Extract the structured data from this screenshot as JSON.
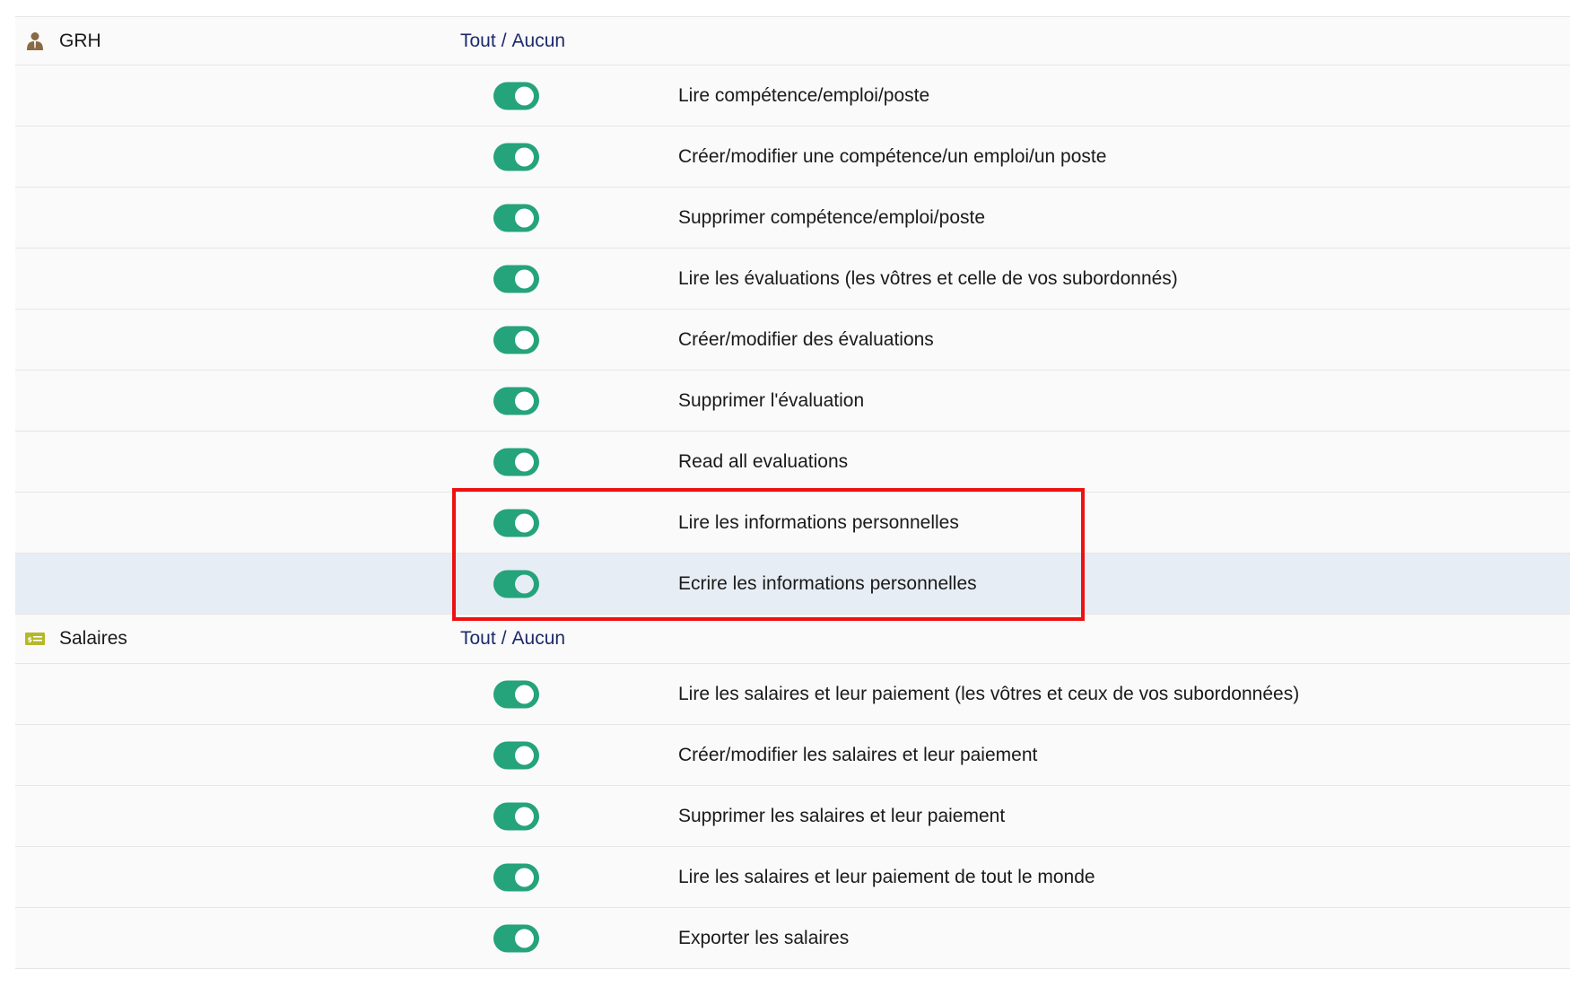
{
  "sections": [
    {
      "name": "GRH",
      "icon": "person-icon",
      "select_all": "Tout",
      "separator": "/",
      "select_none": "Aucun",
      "permissions": [
        {
          "label": "Lire compétence/emploi/poste",
          "enabled": true
        },
        {
          "label": "Créer/modifier une compétence/un emploi/un poste",
          "enabled": true
        },
        {
          "label": "Supprimer compétence/emploi/poste",
          "enabled": true
        },
        {
          "label": "Lire les évaluations (les vôtres et celle de vos subordonnés)",
          "enabled": true
        },
        {
          "label": "Créer/modifier des évaluations",
          "enabled": true
        },
        {
          "label": "Supprimer l'évaluation",
          "enabled": true
        },
        {
          "label": "Read all evaluations",
          "enabled": true
        },
        {
          "label": "Lire les informations personnelles",
          "enabled": true
        },
        {
          "label": "Ecrire les informations personnelles",
          "enabled": true
        }
      ]
    },
    {
      "name": "Salaires",
      "icon": "salary-bill-icon",
      "select_all": "Tout",
      "separator": "/",
      "select_none": "Aucun",
      "permissions": [
        {
          "label": "Lire les salaires et leur paiement (les vôtres et ceux de vos subordonnées)",
          "enabled": true
        },
        {
          "label": "Créer/modifier les salaires et leur paiement",
          "enabled": true
        },
        {
          "label": "Supprimer les salaires et leur paiement",
          "enabled": true
        },
        {
          "label": "Lire les salaires et leur paiement de tout le monde",
          "enabled": true
        },
        {
          "label": "Exporter les salaires",
          "enabled": true
        }
      ]
    }
  ],
  "colors": {
    "toggle_on": "#25a37b",
    "link": "#1c2a6b",
    "highlight_row": "#e7edf4",
    "annotation_box": "#ee1111"
  }
}
